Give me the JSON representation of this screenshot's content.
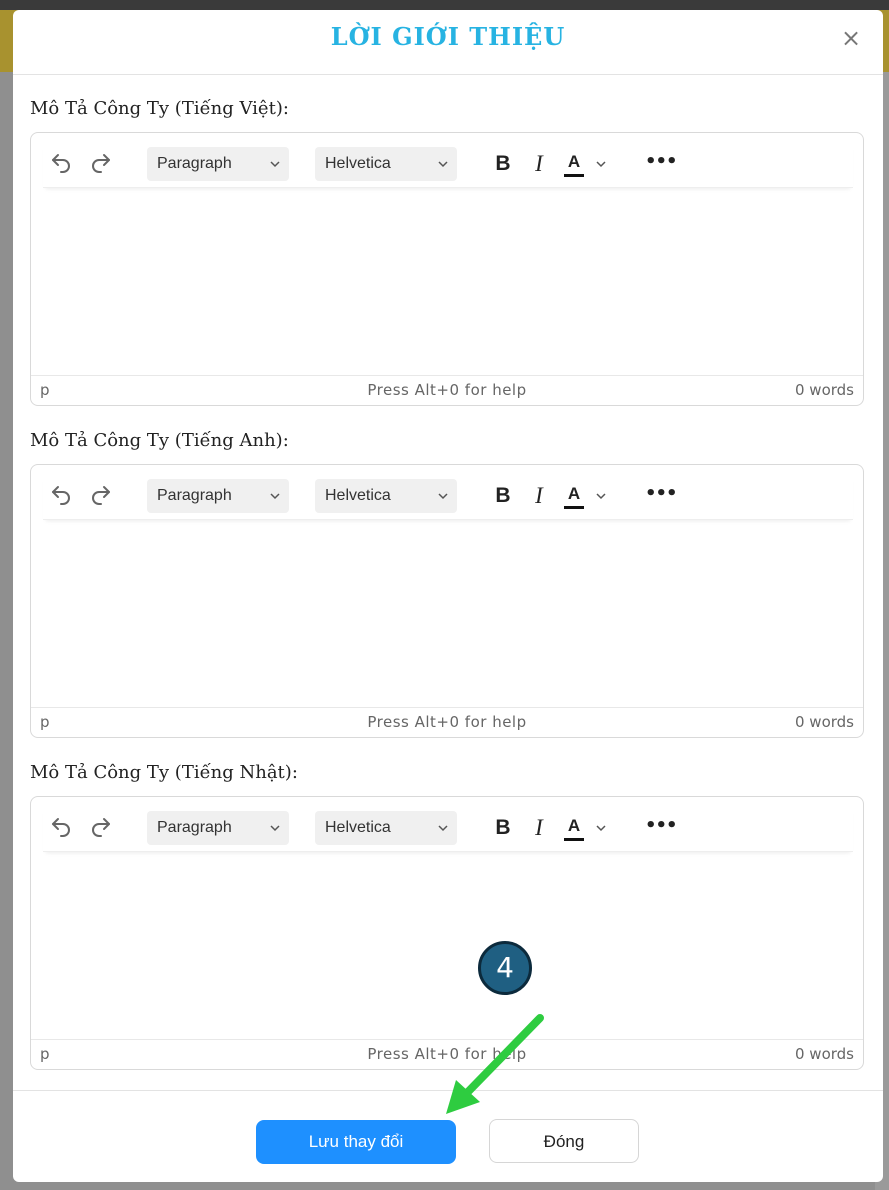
{
  "modal": {
    "title": "LỜI GIỚI THIỆU",
    "close_symbol": "×"
  },
  "editors": [
    {
      "label": "Mô Tả Công Ty (Tiếng Việt):",
      "block_format": "Paragraph",
      "font_family": "Helvetica",
      "status_path": "p",
      "help_text": "Press Alt+0 for help",
      "word_count": "0 words"
    },
    {
      "label": "Mô Tả Công Ty (Tiếng Anh):",
      "block_format": "Paragraph",
      "font_family": "Helvetica",
      "status_path": "p",
      "help_text": "Press Alt+0 for help",
      "word_count": "0 words"
    },
    {
      "label": "Mô Tả Công Ty (Tiếng Nhật):",
      "block_format": "Paragraph",
      "font_family": "Helvetica",
      "status_path": "p",
      "help_text": "Press Alt+0 for help",
      "word_count": "0 words"
    }
  ],
  "toolbar": {
    "bold_label": "B",
    "italic_label": "I",
    "text_color_label": "A",
    "more_label": "•••",
    "icons": [
      "undo-icon",
      "redo-icon",
      "chevron-down-icon"
    ]
  },
  "footer": {
    "save_label": "Lưu thay đổi",
    "close_label": "Đóng"
  },
  "annotation": {
    "step_number": "4",
    "color": "#2ecc40"
  },
  "colors": {
    "title": "#27b3e2",
    "primary_button": "#1e90ff",
    "badge": "#1f5f82"
  }
}
